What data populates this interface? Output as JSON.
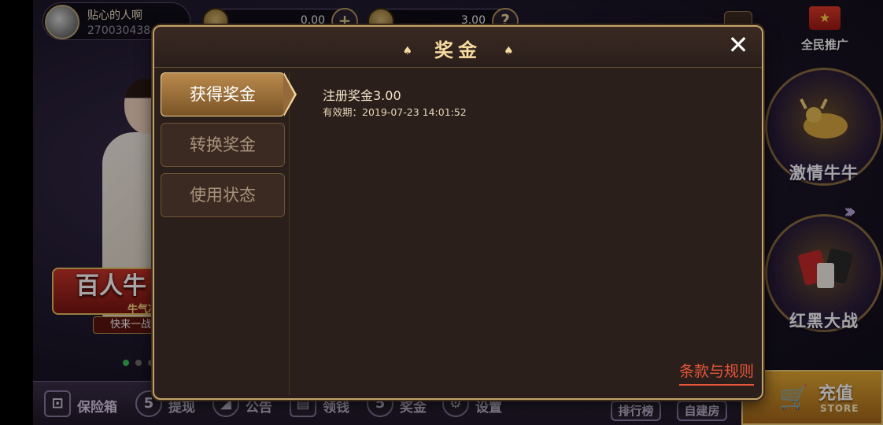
{
  "profile": {
    "nickname": "贴心的人啊",
    "uid": "270030438"
  },
  "currency": {
    "gold_value": "0.00",
    "gold_add": "+",
    "bonus_value": "3.00",
    "bonus_help": "?"
  },
  "promo": {
    "label": "全民推广",
    "flag_glyph": "★"
  },
  "games": [
    {
      "title": "激情牛牛"
    },
    {
      "title": "红黑大战"
    }
  ],
  "showcase": {
    "banner_big": "百人牛",
    "banner_sub": "牛气冲",
    "banner_call": "快来一战"
  },
  "bottom_bar": {
    "items": [
      {
        "label": "保险箱",
        "glyph": "⊡"
      },
      {
        "label": "提现",
        "glyph": "5"
      },
      {
        "label": "公告",
        "glyph": "◢"
      },
      {
        "label": "领钱",
        "glyph": "▤"
      },
      {
        "label": "奖金",
        "glyph": "5"
      },
      {
        "label": "设置",
        "glyph": "⚙"
      }
    ],
    "rank_button": "排行榜",
    "create_room_button": "自建房",
    "store": {
      "label": "充值",
      "sub": "STORE",
      "glyph": "🛒"
    }
  },
  "modal": {
    "title": "奖金",
    "title_ornament": "♠",
    "close_label": "✕",
    "tabs": [
      {
        "label": "获得奖金",
        "active": true
      },
      {
        "label": "转换奖金",
        "active": false
      },
      {
        "label": "使用状态",
        "active": false
      }
    ],
    "bonus": {
      "name": "注册奖金3.00",
      "expiry": "有效期：2019-07-23 14:01:52"
    },
    "terms_link": "条款与规则"
  },
  "colors": {
    "accent_gold": "#c4a36a",
    "terms_red": "#e4553a",
    "modal_bg": "#2b1f1b"
  }
}
